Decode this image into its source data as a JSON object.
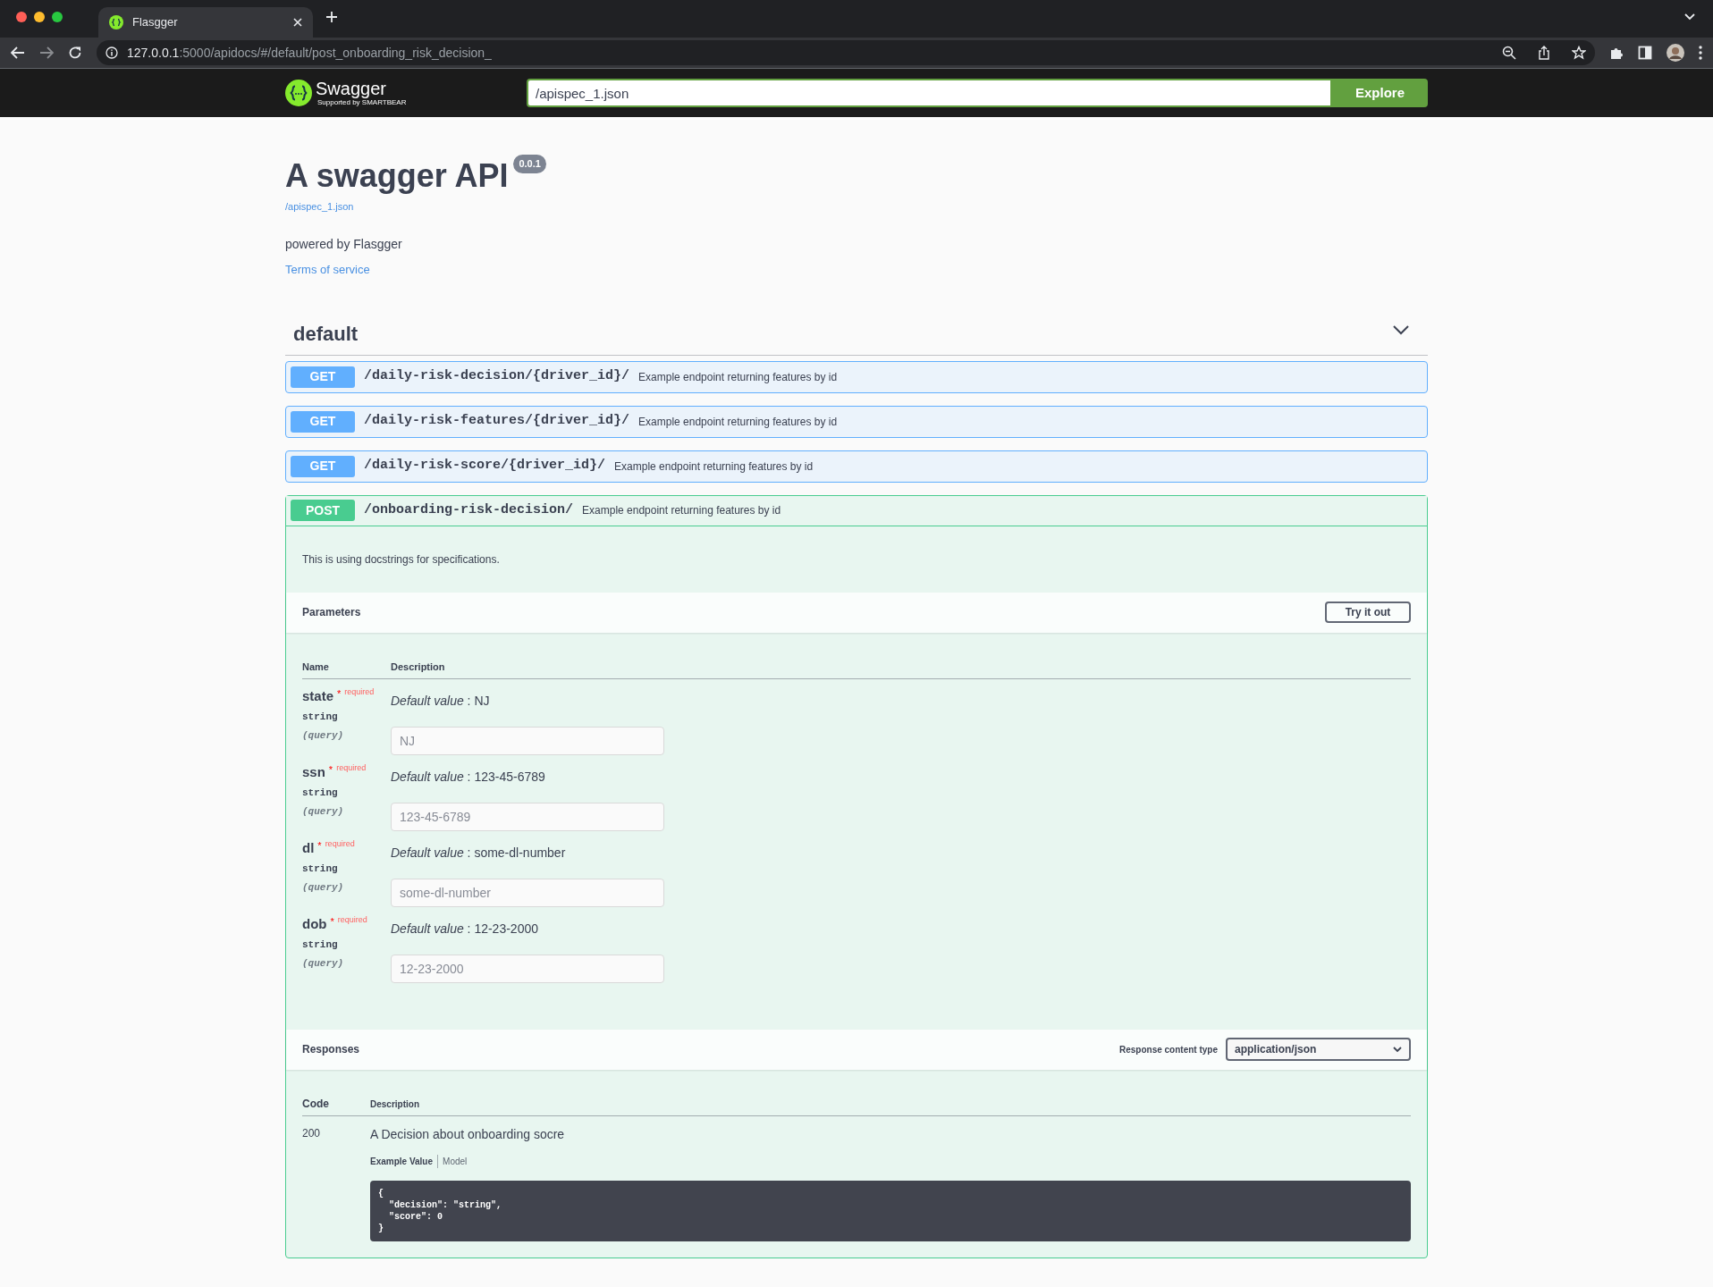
{
  "browser": {
    "tab": {
      "title": "Flasgger",
      "selected": true
    },
    "url": {
      "host": "127.0.0.1",
      "rest": ":5000/apidocs/#/default/post_onboarding_risk_decision_"
    }
  },
  "topbar": {
    "logo_text": "Swagger",
    "logo_sub": "Supported by SMARTBEAR",
    "spec_url": "/apispec_1.json",
    "explore": "Explore"
  },
  "info": {
    "title": "A swagger API",
    "version": "0.0.1",
    "spec_link": "/apispec_1.json",
    "description": "powered by Flasgger",
    "terms": "Terms of service"
  },
  "section": {
    "title": "default",
    "expanded": true
  },
  "operations": [
    {
      "method": "GET",
      "path": "/daily-risk-decision/{driver_id}/",
      "summary": "Example endpoint returning features by id",
      "expanded": false
    },
    {
      "method": "GET",
      "path": "/daily-risk-features/{driver_id}/",
      "summary": "Example endpoint returning features by id",
      "expanded": false
    },
    {
      "method": "GET",
      "path": "/daily-risk-score/{driver_id}/",
      "summary": "Example endpoint returning features by id",
      "expanded": false
    },
    {
      "method": "POST",
      "path": "/onboarding-risk-decision/",
      "summary": "Example endpoint returning features by id",
      "expanded": true
    }
  ],
  "details": {
    "description": "This is using docstrings for specifications.",
    "parameters_title": "Parameters",
    "try_button": "Try it out",
    "param_columns": [
      "Name",
      "Description"
    ],
    "parameters": [
      {
        "name": "state",
        "star": "*",
        "required": "required",
        "type": "string",
        "location": "(query)",
        "default_label": "Default value",
        "default_value": " : NJ",
        "placeholder": "NJ"
      },
      {
        "name": "ssn",
        "star": "*",
        "required": "required",
        "type": "string",
        "location": "(query)",
        "default_label": "Default value",
        "default_value": " : 123-45-6789",
        "placeholder": "123-45-6789"
      },
      {
        "name": "dl",
        "star": "*",
        "required": "required",
        "type": "string",
        "location": "(query)",
        "default_label": "Default value",
        "default_value": " : some-dl-number",
        "placeholder": "some-dl-number"
      },
      {
        "name": "dob",
        "star": "*",
        "required": "required",
        "type": "string",
        "location": "(query)",
        "default_label": "Default value",
        "default_value": " : 12-23-2000",
        "placeholder": "12-23-2000"
      }
    ],
    "responses_title": "Responses",
    "content_type_label": "Response content type",
    "content_type": "application/json",
    "response_columns": [
      "Code",
      "Description"
    ],
    "responses": [
      {
        "code": "200",
        "description": "A Decision about onboarding socre",
        "tabs": [
          {
            "label": "Example Value",
            "selected": true
          },
          {
            "label": "Model",
            "selected": false
          }
        ],
        "example": "{\n  \"decision\": \"string\",\n  \"score\": 0\n}"
      }
    ]
  }
}
